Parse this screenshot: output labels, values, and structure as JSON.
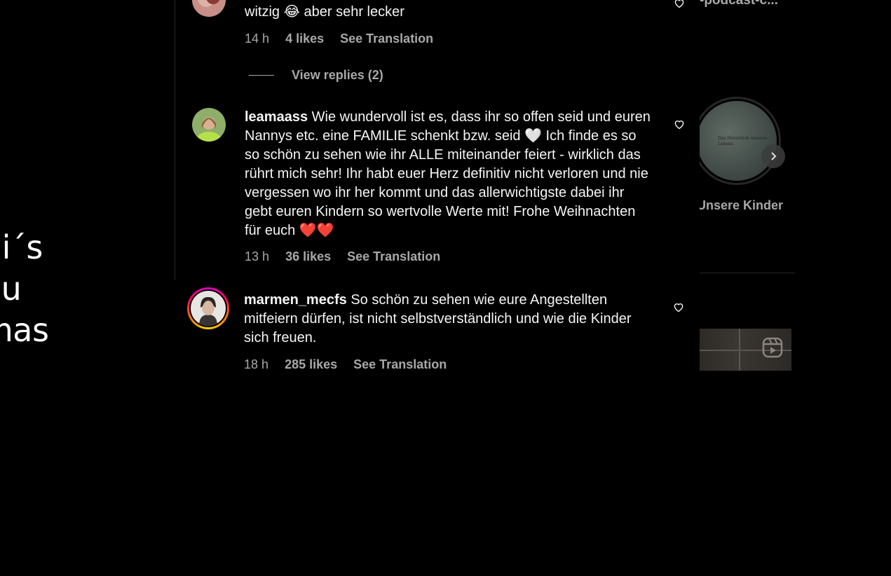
{
  "post_overlay_text": "ni´s\nou\nmas",
  "comments": [
    {
      "text": "witzig 😂 aber sehr lecker",
      "time": "14 h",
      "likes": "4 likes",
      "see_translation": "See Translation"
    },
    {
      "username": "leamaass",
      "text": "Wie wundervoll ist es, dass ihr so offen seid und euren Nannys etc. eine FAMILIE schenkt bzw. seid 🤍 Ich finde es so so schön zu sehen wie ihr ALLE miteinander feiert - wirklich das rührt mich sehr! Ihr habt euer Herz definitiv nicht verloren und nie vergessen wo ihr her kommt und das allerwichtigste dabei ihr gebt euren Kindern so wertvolle Werte mit! Frohe Weihnachten für euch ❤️❤️",
      "time": "13 h",
      "likes": "36 likes",
      "see_translation": "See Translation"
    },
    {
      "username": "marmen_mecfs",
      "text": "So schön zu sehen wie eure Angestellten mitfeiern dürfen, ist nicht selbstverständlich und wie die Kinder sich freuen.",
      "time": "18 h",
      "likes": "285 likes",
      "see_translation": "See Translation"
    }
  ],
  "view_replies": "View replies (2)",
  "sidebar": {
    "title_partial": "-podcast-c...",
    "highlight_label": "Unsere Kinder",
    "highlight_image_text": "Das Herzstück unseres Lebens"
  },
  "icons": {
    "heart": "heart-outline-icon",
    "next": "chevron-right-icon",
    "reels": "reels-icon"
  }
}
